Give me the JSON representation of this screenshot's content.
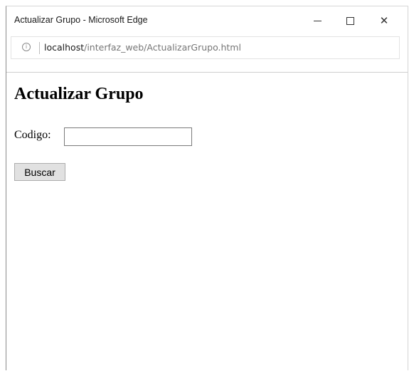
{
  "window": {
    "title": "Actualizar Grupo - Microsoft Edge",
    "controls": {
      "minimize_icon": "minimize-icon",
      "maximize_icon": "maximize-icon",
      "close_glyph": "✕"
    }
  },
  "addressbar": {
    "info_glyph": "i",
    "url_host": "localhost",
    "url_path": "/interfaz_web/ActualizarGrupo.html"
  },
  "page": {
    "heading": "Actualizar Grupo",
    "codigo_label": "Codigo:",
    "codigo_value": "",
    "buscar_label": "Buscar"
  }
}
